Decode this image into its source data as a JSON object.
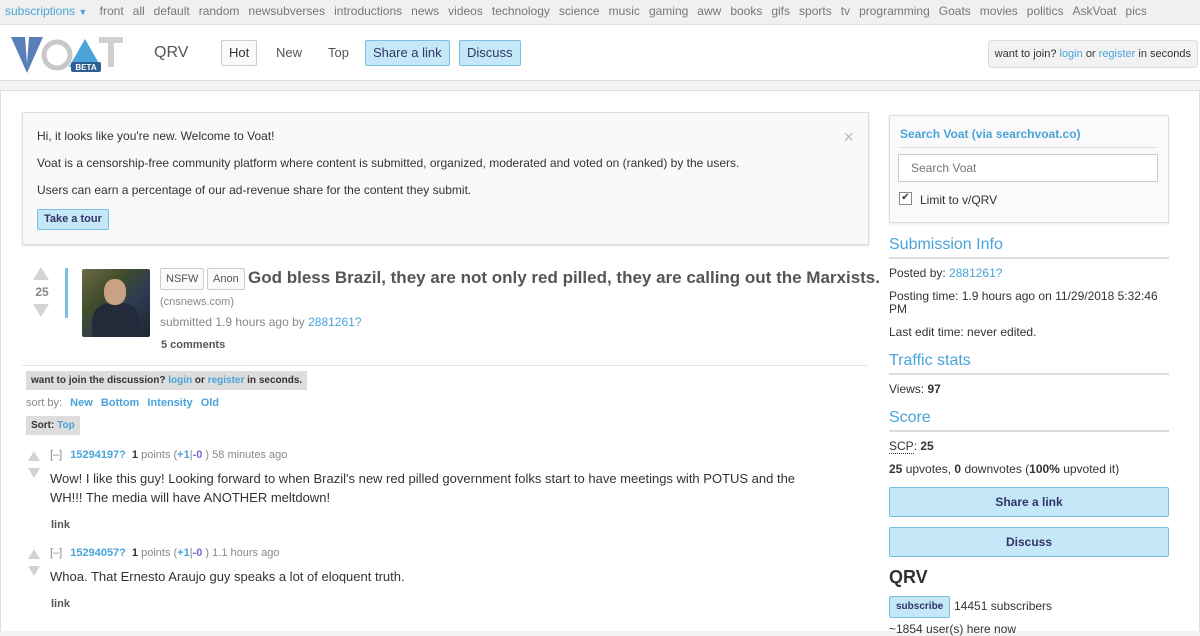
{
  "topbar": {
    "subscriptions": "subscriptions",
    "items": [
      "front",
      "all",
      "default",
      "random",
      "newsubverses",
      "introductions",
      "news",
      "videos",
      "technology",
      "science",
      "music",
      "gaming",
      "aww",
      "books",
      "gifs",
      "sports",
      "tv",
      "programming",
      "Goats",
      "movies",
      "politics",
      "AskVoat",
      "pics"
    ]
  },
  "header": {
    "logo_text": "VOAT",
    "logo_badge": "BETA",
    "subverse": "QRV",
    "tabs": {
      "hot": "Hot",
      "new": "New",
      "top": "Top"
    },
    "share_link": "Share a link",
    "discuss": "Discuss",
    "join": {
      "prefix": "want to join?",
      "login": "login",
      "or": "or",
      "register": "register",
      "suffix": "in seconds"
    }
  },
  "welcome": {
    "line1": "Hi, it looks like you're new. Welcome to Voat!",
    "line2": "Voat is a censorship-free community platform where content is submitted, organized, moderated and voted on (ranked) by the users.",
    "line3": "Users can earn a percentage of our ad-revenue share for the content they submit.",
    "tour": "Take a tour",
    "close": "×"
  },
  "post": {
    "score": "25",
    "tags": [
      "NSFW",
      "Anon"
    ],
    "title": "God bless Brazil, they are not only red pilled, they are calling out the Marxists.",
    "domain_open": "(",
    "domain": "cnsnews.com",
    "domain_close": ")",
    "submitted_prefix": "submitted 1.9 hours ago by",
    "author": "2881261?",
    "comments": "5 comments"
  },
  "discussion": {
    "join": {
      "prefix": "want to join the discussion?",
      "login": "login",
      "or": "or",
      "register": "register",
      "suffix": "in seconds."
    },
    "sort_by": "sort by:",
    "sort_options": [
      "New",
      "Bottom",
      "Intensity",
      "Old"
    ],
    "sort_label": "Sort:",
    "sort_current": "Top"
  },
  "comments": [
    {
      "collapse": "[–]",
      "user": "15294197?",
      "points": "1",
      "points_label": "points (",
      "plus": "+1",
      "sep": "|",
      "minus": "-0",
      "close": ")",
      "time": "58 minutes ago",
      "body": "Wow! I like this guy! Looking forward to when Brazil's new red pilled government folks start to have meetings with POTUS and the WH!!! The media will have ANOTHER meltdown!",
      "link": "link"
    },
    {
      "collapse": "[–]",
      "user": "15294057?",
      "points": "1",
      "points_label": "points (",
      "plus": "+1",
      "sep": "|",
      "minus": "-0",
      "close": ")",
      "time": "1.1 hours ago",
      "body": "Whoa. That Ernesto Araujo guy speaks a lot of eloquent truth.",
      "link": "link"
    }
  ],
  "sidebar": {
    "search": {
      "heading": "Search Voat (via searchvoat.co)",
      "placeholder": "Search Voat",
      "limit": "Limit to v/QRV",
      "checked": true,
      "check_glyph": "✔"
    },
    "submission_info": {
      "heading": "Submission Info",
      "posted_by_label": "Posted by:",
      "posted_by": "2881261?",
      "posting_time": "Posting time: 1.9 hours ago on 11/29/2018 5:32:46 PM",
      "last_edit": "Last edit time: never edited."
    },
    "traffic": {
      "heading": "Traffic stats",
      "views_label": "Views:",
      "views": "97"
    },
    "score": {
      "heading": "Score",
      "scp_label": "SCP",
      "scp_colon": ":",
      "scp": "25",
      "upvotes": "25",
      "upvotes_label": "upvotes,",
      "downvotes": "0",
      "downvotes_label": "downvotes (",
      "percent": "100%",
      "percent_label": "upvoted it)"
    },
    "share_link": "Share a link",
    "discuss": "Discuss",
    "sub": {
      "name": "QRV",
      "subscribe": "subscribe",
      "subscribers": "14451 subscribers",
      "here_now": "~1854 user(s) here now"
    }
  },
  "colors": {
    "accent": "#4aa3d9",
    "button_bg": "#c5e8f8",
    "button_border": "#7bbfe0",
    "minus": "#7a6ad8"
  }
}
